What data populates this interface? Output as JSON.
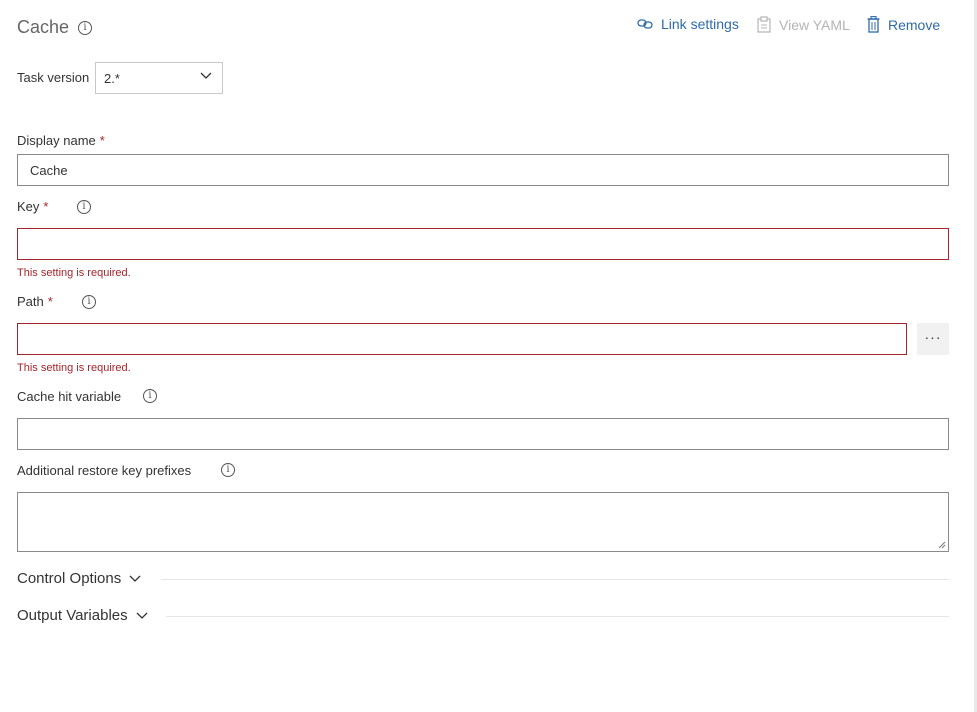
{
  "header": {
    "title": "Cache",
    "link_settings": "Link settings",
    "view_yaml": "View YAML",
    "remove": "Remove"
  },
  "task_version": {
    "label": "Task version",
    "value": "2.*"
  },
  "fields": {
    "display_name": {
      "label": "Display name",
      "required": "*",
      "value": "Cache"
    },
    "key": {
      "label": "Key",
      "required": "*",
      "value": "",
      "error": "This setting is required."
    },
    "path": {
      "label": "Path",
      "required": "*",
      "value": "",
      "error": "This setting is required.",
      "browse": "···"
    },
    "cache_hit_variable": {
      "label": "Cache hit variable",
      "value": ""
    },
    "restore_keys": {
      "label": "Additional restore key prefixes",
      "value": ""
    }
  },
  "sections": {
    "control_options": "Control Options",
    "output_variables": "Output Variables"
  },
  "colors": {
    "accent": "#2f6ba8",
    "error": "#a4262c",
    "disabled": "#b4b4b4"
  }
}
